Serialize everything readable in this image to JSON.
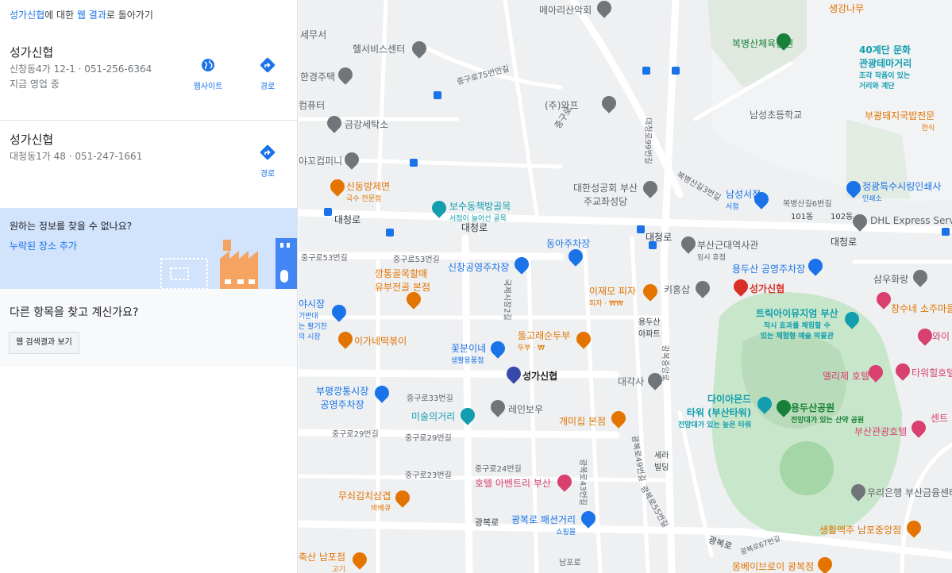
{
  "panel": {
    "top_link_place": "성가신협",
    "top_link_mid": "에 대한 ",
    "top_link_web": "웹 결과",
    "top_link_tail": "로 돌아가기",
    "results": [
      {
        "name": "성가신협",
        "address": "신창동4가 12-1 · 051-256-6364",
        "status": "지금 영업 중",
        "website_label": "웹사이트",
        "directions_label": "경로"
      },
      {
        "name": "성가신협",
        "address": "대청동1가 48 · 051-247-1661",
        "directions_label": "경로"
      }
    ],
    "missing": {
      "question": "원하는 정보를 찾을 수 없나요?",
      "link": "누락된 장소 추가"
    },
    "other": {
      "question": "다른 항목을 찾고 계신가요?",
      "button": "웹 검색결과 보기"
    }
  },
  "map": {
    "colors": {
      "road": "#ffffff",
      "block": "#f1f3f4",
      "park": "#c8e6c9",
      "blue_poi": "#1a73e8",
      "orange_poi": "#e37400",
      "pink_poi": "#d93f6f",
      "red_pin": "#d93025",
      "bank_pin": "#3949ab",
      "grey_poi": "#70757a",
      "green_poi": "#188038",
      "teal_poi": "#129eaf"
    },
    "road_labels": [
      {
        "text": "대청로"
      },
      {
        "text": "대청로"
      },
      {
        "text": "대청로"
      },
      {
        "text": "대청로"
      },
      {
        "text": "중구로"
      },
      {
        "text": "중구로53번길"
      },
      {
        "text": "중구로53번길"
      },
      {
        "text": "중구로33번길"
      },
      {
        "text": "중구로29번길"
      },
      {
        "text": "중구로29번길"
      },
      {
        "text": "중구로23번길"
      },
      {
        "text": "중구로24번길"
      },
      {
        "text": "광복로"
      },
      {
        "text": "광복로"
      },
      {
        "text": "광복로67번길"
      },
      {
        "text": "중구로75번안길"
      },
      {
        "text": "광복로43번길"
      },
      {
        "text": "광복로55번길"
      },
      {
        "text": "광복로49번길"
      },
      {
        "text": "광복중앙로"
      },
      {
        "text": "대청로99번길"
      },
      {
        "text": "국제시장2길"
      },
      {
        "text": "복병산길3번길"
      },
      {
        "text": "복병산길6번길"
      }
    ],
    "pois": [
      {
        "name": "메아리산악회",
        "color": "grey"
      },
      {
        "name": "복병산체육공원",
        "color": "green"
      },
      {
        "name": "40계단 문화",
        "line2": "관광테마거리",
        "sub": "조각 작품이 있는",
        "sub2": "거리와 계단",
        "color": "teal"
      },
      {
        "name": "생강나무",
        "color": "orange"
      },
      {
        "name": "세무서",
        "color": "grey"
      },
      {
        "name": "헬서비스센터",
        "color": "grey"
      },
      {
        "name": "한경주택",
        "color": "grey"
      },
      {
        "name": "컴퓨터",
        "color": "grey"
      },
      {
        "name": "(주)와프",
        "color": "grey"
      },
      {
        "name": "금강세탁소",
        "color": "grey"
      },
      {
        "name": "남성초등학교",
        "color": "grey"
      },
      {
        "name": "부광돼지국밥전문",
        "sub": "한식",
        "color": "orange"
      },
      {
        "name": "야꼬컴퍼니",
        "color": "grey"
      },
      {
        "name": "대한성공회 부산",
        "line2": "주교좌성당",
        "color": "grey"
      },
      {
        "name": "신동방제면",
        "sub": "국수 전문점",
        "color": "orange"
      },
      {
        "name": "보수동책방골목",
        "sub": "서점이 늘어선 골목",
        "color": "teal"
      },
      {
        "name": "남성서점",
        "sub": "서점",
        "color": "blue"
      },
      {
        "name": "정광특수시링인쇄사",
        "sub": "인쇄소",
        "color": "blue"
      },
      {
        "name": "DHL Express Servi",
        "color": "grey"
      },
      {
        "name": "101동",
        "color": "grey"
      },
      {
        "name": "102동",
        "color": "grey"
      },
      {
        "name": "부산근대역사관",
        "sub": "임시 휴점",
        "color": "grey"
      },
      {
        "name": "동아주차장",
        "color": "blue"
      },
      {
        "name": "신창공영주차장",
        "color": "blue"
      },
      {
        "name": "용두산 공영주차장",
        "color": "blue"
      },
      {
        "name": "깡통골목할매",
        "line2": "유부전골 본점",
        "color": "orange"
      },
      {
        "name": "이재모 피자",
        "sub": "피자 · ₩₩",
        "color": "orange"
      },
      {
        "name": "키홍삽",
        "color": "grey"
      },
      {
        "name": "성가신협",
        "color": "red"
      },
      {
        "name": "삼우화랑",
        "color": "grey"
      },
      {
        "name": "야시장",
        "sub": "기반대",
        "sub2": "는 활기찬",
        "sub3": "의 시장",
        "color": "blue"
      },
      {
        "name": "용두산",
        "line2": "아파트",
        "color": "grey"
      },
      {
        "name": "트릭아이뮤지엄 부산",
        "sub": "착시 효과를 체험할 수",
        "sub2": "있는 체험형 예술 박물관",
        "color": "teal"
      },
      {
        "name": "창수네 소주마을",
        "color": "orange"
      },
      {
        "name": "와이",
        "color": "pink"
      },
      {
        "name": "이가네떡볶이",
        "color": "orange"
      },
      {
        "name": "돌고래순두부",
        "sub": "두부 · ₩",
        "color": "orange"
      },
      {
        "name": "꽃분이네",
        "sub": "생활용품점",
        "color": "blue"
      },
      {
        "name": "성가신협",
        "color": "bank"
      },
      {
        "name": "대각사",
        "color": "grey"
      },
      {
        "name": "엘리제 호텔",
        "color": "pink"
      },
      {
        "name": "타워힐호텔",
        "color": "pink"
      },
      {
        "name": "부평깡통시장",
        "line2": "공영주차장",
        "color": "blue"
      },
      {
        "name": "레인보우",
        "color": "grey"
      },
      {
        "name": "다이아몬드",
        "line2": "타워 (부산타워)",
        "sub": "전망대가 있는 높은 타워",
        "color": "teal"
      },
      {
        "name": "용두산공원",
        "sub": "전망대가 있는 산약 공원",
        "color": "green"
      },
      {
        "name": "미술의거리",
        "color": "teal"
      },
      {
        "name": "개미집 본점",
        "color": "orange"
      },
      {
        "name": "부산관광호텔",
        "color": "pink"
      },
      {
        "name": "센트",
        "color": "pink"
      },
      {
        "name": "호텔 아벤트리 부산",
        "color": "pink"
      },
      {
        "name": "무쇠김치삼겹",
        "sub": "바베큐",
        "color": "orange"
      },
      {
        "name": "우리은행 부산금융센터",
        "color": "grey"
      },
      {
        "name": "광복로 패션거리",
        "sub": "쇼핑몰",
        "color": "blue"
      },
      {
        "name": "생활맥주 남포중앙점",
        "color": "orange"
      },
      {
        "name": "축산 남포점",
        "sub": "고기",
        "color": "orange"
      },
      {
        "name": "남포로",
        "color": "grey"
      },
      {
        "name": "몽베이브로이 광복점",
        "color": "orange"
      },
      {
        "name": "세라",
        "line2": "빌딩",
        "color": "grey"
      }
    ]
  }
}
